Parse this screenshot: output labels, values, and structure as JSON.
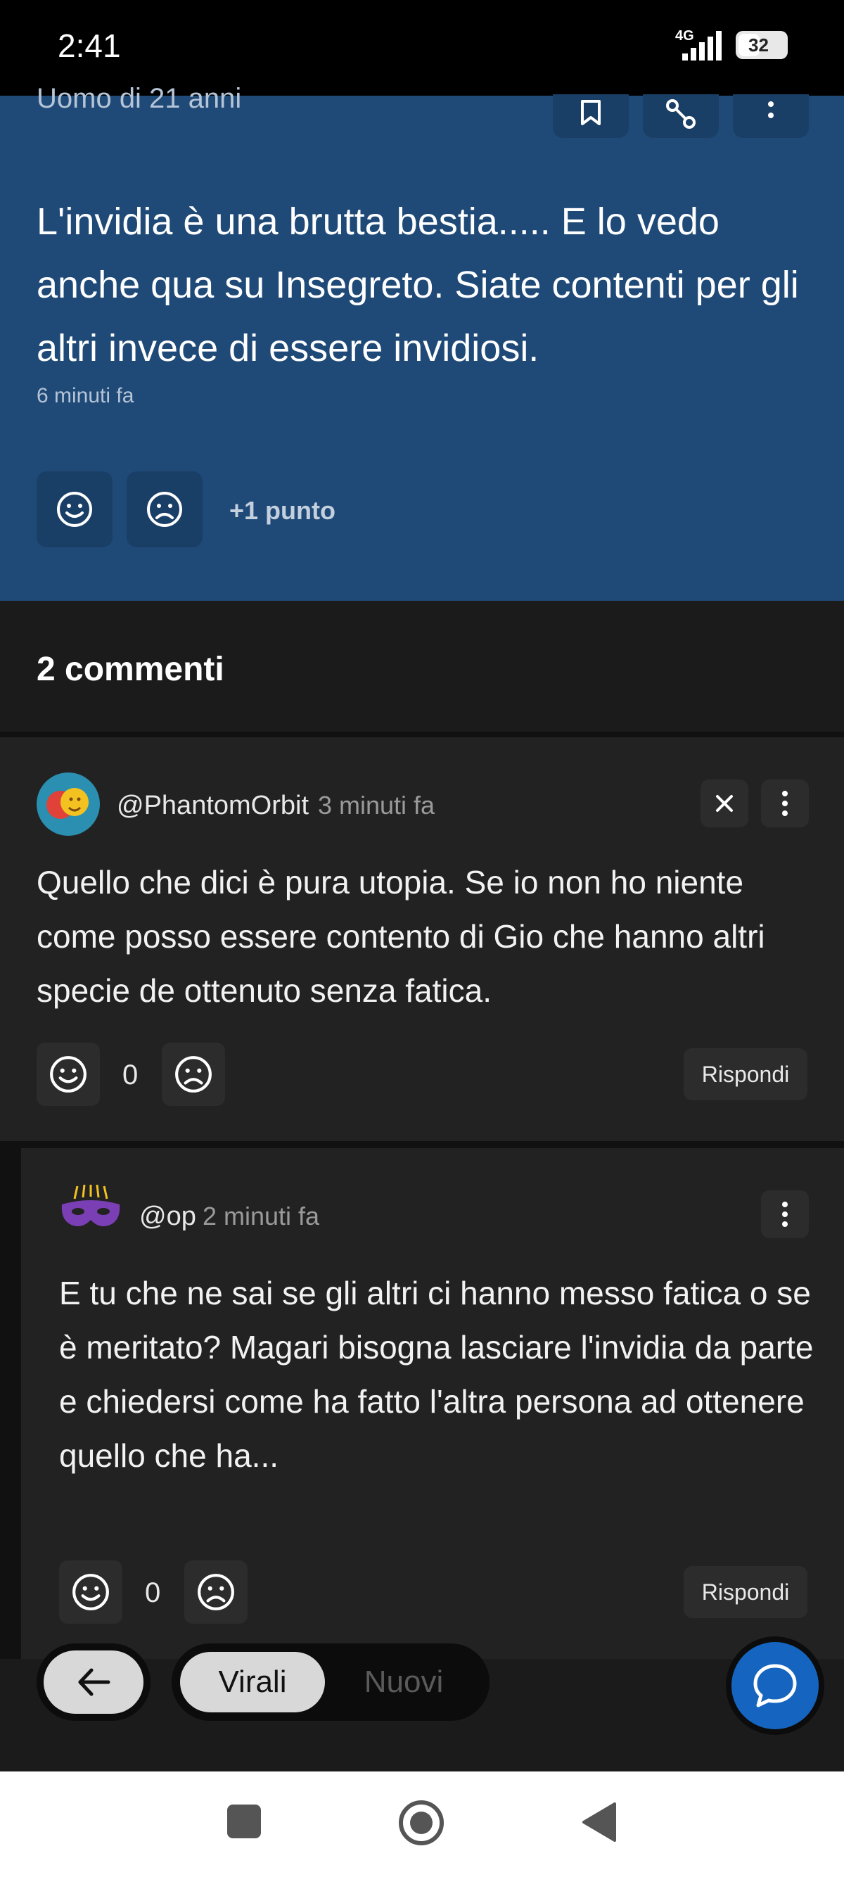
{
  "status_bar": {
    "time": "2:41",
    "network": "4G",
    "battery": "32"
  },
  "post": {
    "author": "Uomo di 21 anni",
    "text": "L'invidia è una brutta bestia..... E lo vedo anche qua su Insegreto. Siate contenti per gli altri invece di essere invidiosi.",
    "time": "6 minuti fa",
    "points": "+1 punto"
  },
  "comments": {
    "title": "2 commenti",
    "items": [
      {
        "handle": "@PhantomOrbit",
        "time": "3 minuti fa",
        "text": "Quello che dici è pura utopia. Se io non ho niente come posso essere contento di Gio che hanno altri specie de ottenuto senza fatica.",
        "count": "0",
        "reply_label": "Rispondi"
      },
      {
        "handle": "@op",
        "time": "2 minuti fa",
        "text": "E tu che ne sai se gli altri ci hanno messo fatica o se è meritato? Magari bisogna lasciare l'invidia da parte e chiedersi come ha fatto l'altra persona ad ottenere quello che ha...",
        "count": "0",
        "reply_label": "Rispondi"
      }
    ]
  },
  "bottom_bar": {
    "tab_active": "Virali",
    "tab_inactive": "Nuovi"
  },
  "colors": {
    "post_bg": "#1f4a78",
    "accent": "#1565c0",
    "comment_bg": "#222222"
  }
}
